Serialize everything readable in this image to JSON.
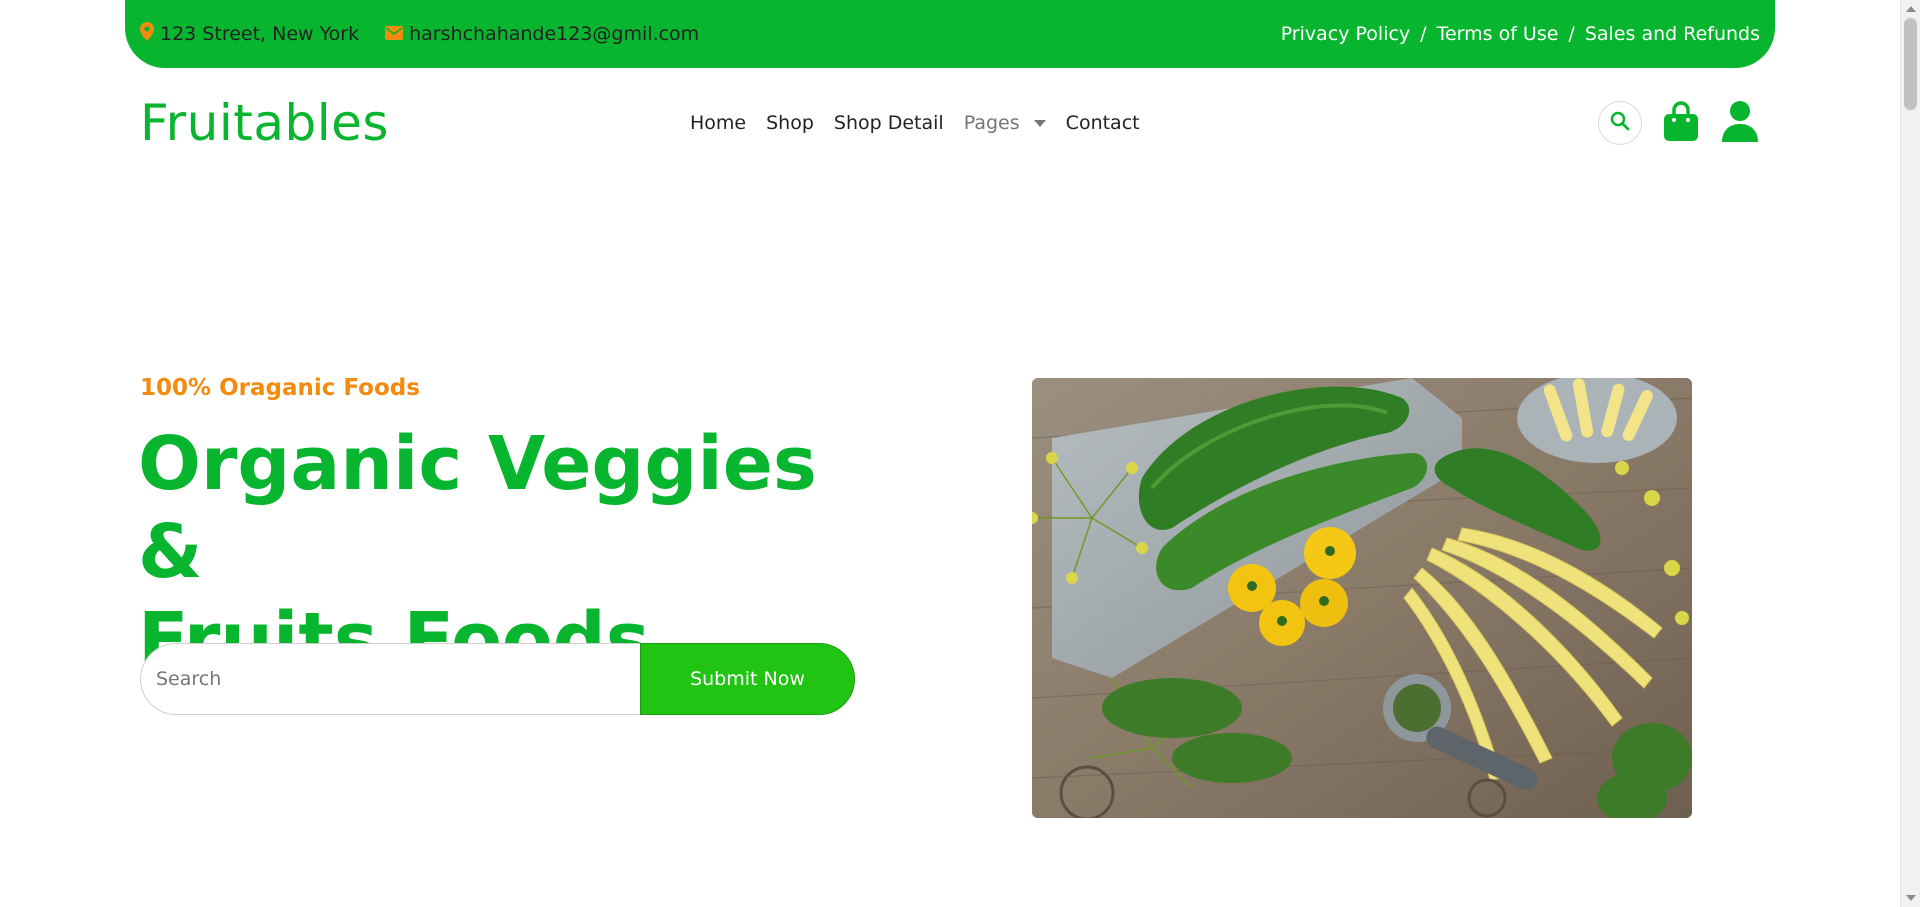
{
  "topbar": {
    "address": "123 Street, New York",
    "email": "harshchahande123@gmil.com",
    "links": [
      "Privacy Policy",
      "Terms of Use",
      "Sales and Refunds"
    ],
    "separator": "/"
  },
  "navbar": {
    "brand": "Fruitables",
    "links": [
      "Home",
      "Shop",
      "Shop Detail",
      "Pages",
      "Contact"
    ]
  },
  "hero": {
    "eyebrow": "100% Oraganic Foods",
    "title_line1": "Organic Veggies &",
    "title_line2": "Fruits Foods",
    "search_placeholder": "Search",
    "submit_label": "Submit Now"
  },
  "colors": {
    "brand_green": "#08b52e",
    "accent_orange": "#f28b0e",
    "button_green": "#22c414"
  },
  "icons": {
    "address": "map-marker-icon",
    "email": "envelope-icon",
    "search": "search-icon",
    "cart": "shopping-bag-icon",
    "user": "user-icon",
    "dropdown": "caret-down-icon"
  }
}
